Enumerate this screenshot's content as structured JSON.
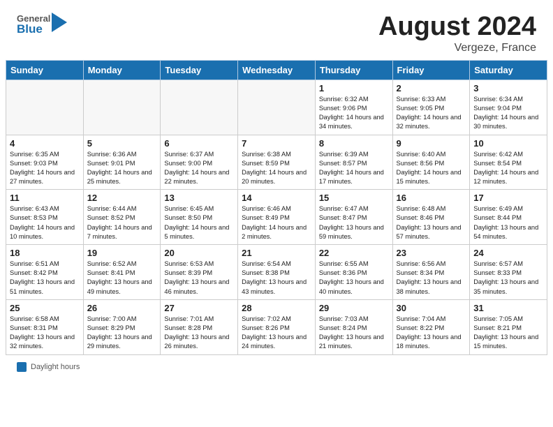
{
  "header": {
    "logo_general": "General",
    "logo_blue": "Blue",
    "title": "August 2024",
    "subtitle": "Vergeze, France"
  },
  "days_of_week": [
    "Sunday",
    "Monday",
    "Tuesday",
    "Wednesday",
    "Thursday",
    "Friday",
    "Saturday"
  ],
  "footer": {
    "daylight_label": "Daylight hours"
  },
  "weeks": [
    [
      {
        "day": "",
        "info": ""
      },
      {
        "day": "",
        "info": ""
      },
      {
        "day": "",
        "info": ""
      },
      {
        "day": "",
        "info": ""
      },
      {
        "day": "1",
        "info": "Sunrise: 6:32 AM\nSunset: 9:06 PM\nDaylight: 14 hours and 34 minutes."
      },
      {
        "day": "2",
        "info": "Sunrise: 6:33 AM\nSunset: 9:05 PM\nDaylight: 14 hours and 32 minutes."
      },
      {
        "day": "3",
        "info": "Sunrise: 6:34 AM\nSunset: 9:04 PM\nDaylight: 14 hours and 30 minutes."
      }
    ],
    [
      {
        "day": "4",
        "info": "Sunrise: 6:35 AM\nSunset: 9:03 PM\nDaylight: 14 hours and 27 minutes."
      },
      {
        "day": "5",
        "info": "Sunrise: 6:36 AM\nSunset: 9:01 PM\nDaylight: 14 hours and 25 minutes."
      },
      {
        "day": "6",
        "info": "Sunrise: 6:37 AM\nSunset: 9:00 PM\nDaylight: 14 hours and 22 minutes."
      },
      {
        "day": "7",
        "info": "Sunrise: 6:38 AM\nSunset: 8:59 PM\nDaylight: 14 hours and 20 minutes."
      },
      {
        "day": "8",
        "info": "Sunrise: 6:39 AM\nSunset: 8:57 PM\nDaylight: 14 hours and 17 minutes."
      },
      {
        "day": "9",
        "info": "Sunrise: 6:40 AM\nSunset: 8:56 PM\nDaylight: 14 hours and 15 minutes."
      },
      {
        "day": "10",
        "info": "Sunrise: 6:42 AM\nSunset: 8:54 PM\nDaylight: 14 hours and 12 minutes."
      }
    ],
    [
      {
        "day": "11",
        "info": "Sunrise: 6:43 AM\nSunset: 8:53 PM\nDaylight: 14 hours and 10 minutes."
      },
      {
        "day": "12",
        "info": "Sunrise: 6:44 AM\nSunset: 8:52 PM\nDaylight: 14 hours and 7 minutes."
      },
      {
        "day": "13",
        "info": "Sunrise: 6:45 AM\nSunset: 8:50 PM\nDaylight: 14 hours and 5 minutes."
      },
      {
        "day": "14",
        "info": "Sunrise: 6:46 AM\nSunset: 8:49 PM\nDaylight: 14 hours and 2 minutes."
      },
      {
        "day": "15",
        "info": "Sunrise: 6:47 AM\nSunset: 8:47 PM\nDaylight: 13 hours and 59 minutes."
      },
      {
        "day": "16",
        "info": "Sunrise: 6:48 AM\nSunset: 8:46 PM\nDaylight: 13 hours and 57 minutes."
      },
      {
        "day": "17",
        "info": "Sunrise: 6:49 AM\nSunset: 8:44 PM\nDaylight: 13 hours and 54 minutes."
      }
    ],
    [
      {
        "day": "18",
        "info": "Sunrise: 6:51 AM\nSunset: 8:42 PM\nDaylight: 13 hours and 51 minutes."
      },
      {
        "day": "19",
        "info": "Sunrise: 6:52 AM\nSunset: 8:41 PM\nDaylight: 13 hours and 49 minutes."
      },
      {
        "day": "20",
        "info": "Sunrise: 6:53 AM\nSunset: 8:39 PM\nDaylight: 13 hours and 46 minutes."
      },
      {
        "day": "21",
        "info": "Sunrise: 6:54 AM\nSunset: 8:38 PM\nDaylight: 13 hours and 43 minutes."
      },
      {
        "day": "22",
        "info": "Sunrise: 6:55 AM\nSunset: 8:36 PM\nDaylight: 13 hours and 40 minutes."
      },
      {
        "day": "23",
        "info": "Sunrise: 6:56 AM\nSunset: 8:34 PM\nDaylight: 13 hours and 38 minutes."
      },
      {
        "day": "24",
        "info": "Sunrise: 6:57 AM\nSunset: 8:33 PM\nDaylight: 13 hours and 35 minutes."
      }
    ],
    [
      {
        "day": "25",
        "info": "Sunrise: 6:58 AM\nSunset: 8:31 PM\nDaylight: 13 hours and 32 minutes."
      },
      {
        "day": "26",
        "info": "Sunrise: 7:00 AM\nSunset: 8:29 PM\nDaylight: 13 hours and 29 minutes."
      },
      {
        "day": "27",
        "info": "Sunrise: 7:01 AM\nSunset: 8:28 PM\nDaylight: 13 hours and 26 minutes."
      },
      {
        "day": "28",
        "info": "Sunrise: 7:02 AM\nSunset: 8:26 PM\nDaylight: 13 hours and 24 minutes."
      },
      {
        "day": "29",
        "info": "Sunrise: 7:03 AM\nSunset: 8:24 PM\nDaylight: 13 hours and 21 minutes."
      },
      {
        "day": "30",
        "info": "Sunrise: 7:04 AM\nSunset: 8:22 PM\nDaylight: 13 hours and 18 minutes."
      },
      {
        "day": "31",
        "info": "Sunrise: 7:05 AM\nSunset: 8:21 PM\nDaylight: 13 hours and 15 minutes."
      }
    ]
  ]
}
